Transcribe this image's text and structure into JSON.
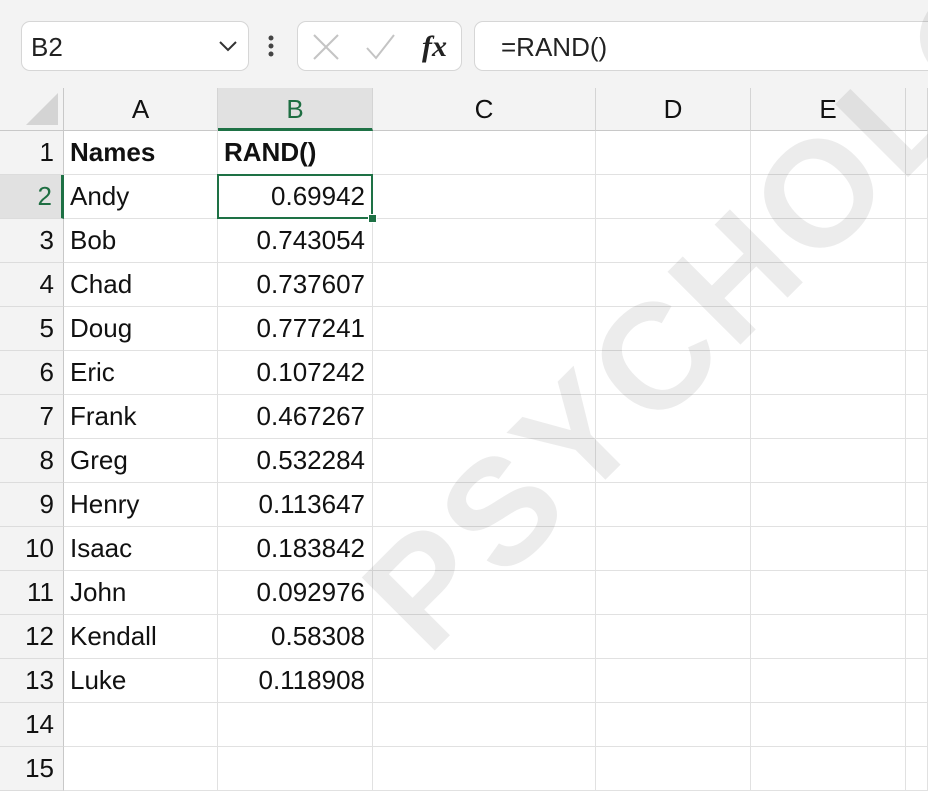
{
  "name_box": {
    "value": "B2"
  },
  "formula_bar": {
    "fx_label": "fx",
    "formula": "=RAND()"
  },
  "columns": [
    "A",
    "B",
    "C",
    "D",
    "E"
  ],
  "active_column": "B",
  "active_row": "2",
  "rows": [
    {
      "num": "1",
      "a": "Names",
      "b": "RAND()"
    },
    {
      "num": "2",
      "a": "Andy",
      "b": "0.69942"
    },
    {
      "num": "3",
      "a": "Bob",
      "b": "0.743054"
    },
    {
      "num": "4",
      "a": "Chad",
      "b": "0.737607"
    },
    {
      "num": "5",
      "a": "Doug",
      "b": "0.777241"
    },
    {
      "num": "6",
      "a": "Eric",
      "b": "0.107242"
    },
    {
      "num": "7",
      "a": "Frank",
      "b": "0.467267"
    },
    {
      "num": "8",
      "a": "Greg",
      "b": "0.532284"
    },
    {
      "num": "9",
      "a": "Henry",
      "b": "0.113647"
    },
    {
      "num": "10",
      "a": "Isaac",
      "b": "0.183842"
    },
    {
      "num": "11",
      "a": "John",
      "b": "0.092976"
    },
    {
      "num": "12",
      "a": "Kendall",
      "b": "0.58308"
    },
    {
      "num": "13",
      "a": "Luke",
      "b": "0.118908"
    },
    {
      "num": "14",
      "a": "",
      "b": ""
    },
    {
      "num": "15",
      "a": "",
      "b": ""
    }
  ],
  "watermark": "PSYCHOLOGY",
  "colors": {
    "accent": "#1e7145"
  }
}
